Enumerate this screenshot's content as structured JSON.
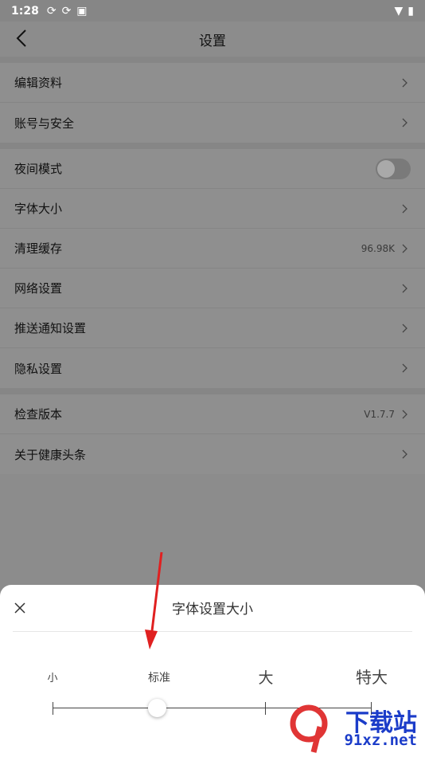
{
  "status_bar": {
    "time": "1:28"
  },
  "header": {
    "title": "设置"
  },
  "groups": [
    {
      "items": [
        {
          "label": "编辑资料"
        },
        {
          "label": "账号与安全"
        }
      ]
    },
    {
      "items": [
        {
          "label": "夜间模式",
          "toggle_on": false
        },
        {
          "label": "字体大小"
        },
        {
          "label": "清理缓存",
          "value": "96.98K"
        },
        {
          "label": "网络设置"
        },
        {
          "label": "推送通知设置"
        },
        {
          "label": "隐私设置"
        }
      ]
    },
    {
      "items": [
        {
          "label": "检查版本",
          "value": "V1.7.7"
        },
        {
          "label": "关于健康头条"
        }
      ]
    }
  ],
  "sheet": {
    "title": "字体设置大小",
    "options": [
      "小",
      "标准",
      "大",
      "特大"
    ],
    "selected": "标准"
  },
  "watermark": {
    "line1": "下载站",
    "line2": "91xz.net"
  }
}
